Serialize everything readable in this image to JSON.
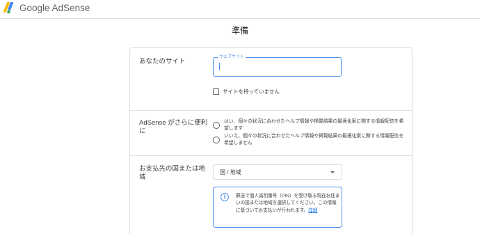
{
  "header": {
    "brand": "Google AdSense",
    "logo_icon": "adsense-logo-icon",
    "logo_colors": [
      "#fbbc04",
      "#4285f4",
      "#34a853"
    ]
  },
  "page": {
    "title": "準備"
  },
  "site_section": {
    "label": "あなたのサイト",
    "input_label": "ウェブサイト",
    "input_value": "",
    "checkbox_label": "サイトを持っていません",
    "checkbox_checked": false
  },
  "tips_section": {
    "label_line1": "AdSense がさらに便利",
    "label_line2": "に",
    "options": [
      {
        "label": "はい、個々の状況に合わせたヘルプ情報や掲載結果の最適化案に関する情報配信を希望します",
        "selected": false
      },
      {
        "label": "いいえ、個々の状況に合わせたヘルプ情報や掲載結果の最適化案に関する情報配信を希望しません",
        "selected": false
      }
    ]
  },
  "country_section": {
    "label_line1": "お支払先の国または地",
    "label_line2": "域",
    "select_value": "国 / 地域",
    "info_text": "郵送で個人識別番号（PIN）を受け取る現在お住まいの国または地域を選択してください。この情報に基づいてお支払いが行われます。",
    "info_link": "詳細"
  },
  "colors": {
    "accent": "#4d90e8",
    "link": "#1a73e8",
    "border": "#e0e0e0"
  }
}
